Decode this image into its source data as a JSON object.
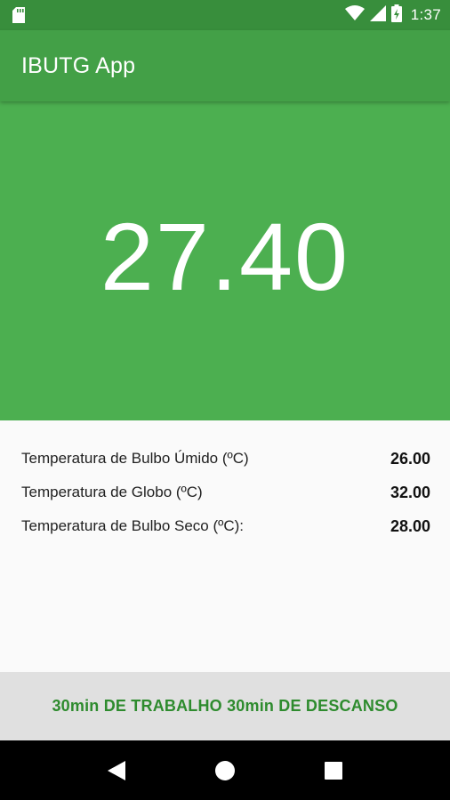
{
  "status_bar": {
    "time": "1:37",
    "icons": [
      "sd-card-icon",
      "wifi-icon",
      "signal-icon",
      "battery-charging-icon"
    ]
  },
  "app_bar": {
    "title": "IBUTG App"
  },
  "hero": {
    "value": "27.40"
  },
  "readings": [
    {
      "label": "Temperatura de Bulbo Úmido (ºC)",
      "value": "26.00"
    },
    {
      "label": "Temperatura de Globo (ºC)",
      "value": "32.00"
    },
    {
      "label": "Temperatura de Bulbo Seco (ºC):",
      "value": "28.00"
    }
  ],
  "recommendation": {
    "text": "30min DE TRABALHO 30min DE DESCANSO"
  },
  "nav_bar": {
    "icons": [
      "back-icon",
      "home-icon",
      "recents-icon"
    ]
  },
  "colors": {
    "status_bar": "#388e3c",
    "app_bar": "#43a047",
    "hero": "#4caf50",
    "recommendation_text": "#2e8b2e",
    "recommendation_bg": "#e0e0e0"
  }
}
